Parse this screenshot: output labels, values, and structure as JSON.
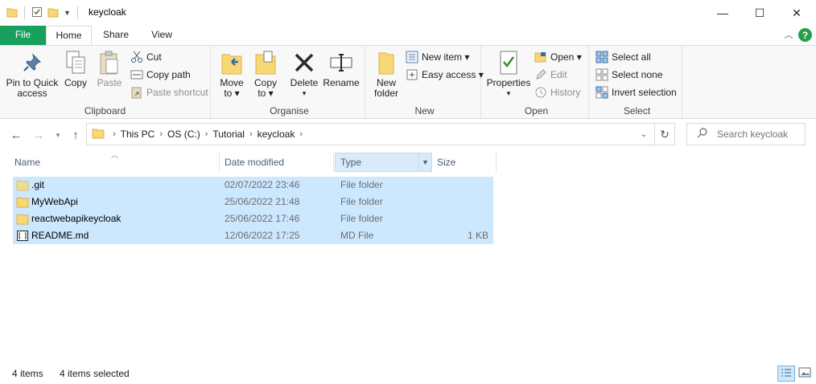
{
  "window": {
    "title": "keycloak",
    "minimize_glyph": "—",
    "maximize_glyph": "☐",
    "close_glyph": "✕"
  },
  "ribbon_tabs": {
    "file": "File",
    "home": "Home",
    "share": "Share",
    "view": "View"
  },
  "clipboard": {
    "pin": "Pin to Quick access",
    "pin_line1": "Pin to Quick",
    "pin_line2": "access",
    "copy": "Copy",
    "paste": "Paste",
    "cut": "Cut",
    "copy_path": "Copy path",
    "paste_shortcut": "Paste shortcut",
    "label": "Clipboard"
  },
  "organise": {
    "move_to": "Move",
    "move_to2": "to ▾",
    "copy_to": "Copy",
    "copy_to2": "to ▾",
    "delete": "Delete",
    "delete2": "▾",
    "rename": "Rename",
    "label": "Organise"
  },
  "new": {
    "new_folder": "New",
    "new_folder2": "folder",
    "new_item": "New item ▾",
    "easy_access": "Easy access ▾",
    "label": "New"
  },
  "open": {
    "properties": "Properties",
    "properties2": "▾",
    "open": "Open ▾",
    "edit": "Edit",
    "history": "History",
    "label": "Open"
  },
  "select": {
    "select_all": "Select all",
    "select_none": "Select none",
    "invert_selection": "Invert selection",
    "label": "Select"
  },
  "breadcrumb": {
    "items": [
      "This PC",
      "OS (C:)",
      "Tutorial",
      "keycloak"
    ]
  },
  "search": {
    "placeholder": "Search keycloak"
  },
  "columns": {
    "name": "Name",
    "date_modified": "Date modified",
    "type": "Type",
    "size": "Size"
  },
  "files": [
    {
      "name": ".git",
      "date": "02/07/2022 23:46",
      "type": "File folder",
      "size": "",
      "kind": "folder"
    },
    {
      "name": "MyWebApi",
      "date": "25/06/2022 21:48",
      "type": "File folder",
      "size": "",
      "kind": "folder"
    },
    {
      "name": "reactwebapikeycloak",
      "date": "25/06/2022 17:46",
      "type": "File folder",
      "size": "",
      "kind": "folder"
    },
    {
      "name": "README.md",
      "date": "12/06/2022 17:25",
      "type": "MD File",
      "size": "1 KB",
      "kind": "file"
    }
  ],
  "status": {
    "count": "4 items",
    "selected": "4 items selected"
  },
  "colors": {
    "file_tab": "#19a05e",
    "selection": "#cce8ff",
    "folder": "#f8d775",
    "help": "#2a9d4a"
  }
}
